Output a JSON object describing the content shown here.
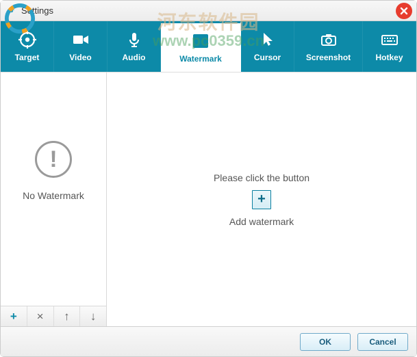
{
  "window": {
    "title": "Settings"
  },
  "tabs": {
    "target": "Target",
    "video": "Video",
    "audio": "Audio",
    "watermark": "Watermark",
    "cursor": "Cursor",
    "screenshot": "Screenshot",
    "hotkey": "Hotkey"
  },
  "sidebar": {
    "empty_label": "No Watermark",
    "toolbar": {
      "add": "+",
      "remove": "×",
      "up": "↑",
      "down": "↓"
    }
  },
  "main": {
    "prompt_line1": "Please click  the button",
    "add_symbol": "+",
    "prompt_line2": "Add watermark"
  },
  "footer": {
    "ok": "OK",
    "cancel": "Cancel"
  },
  "overlay": {
    "text_zh": "河东软件园",
    "text_url": "www.pc0359.cn"
  },
  "colors": {
    "accent": "#0d8aa8"
  }
}
